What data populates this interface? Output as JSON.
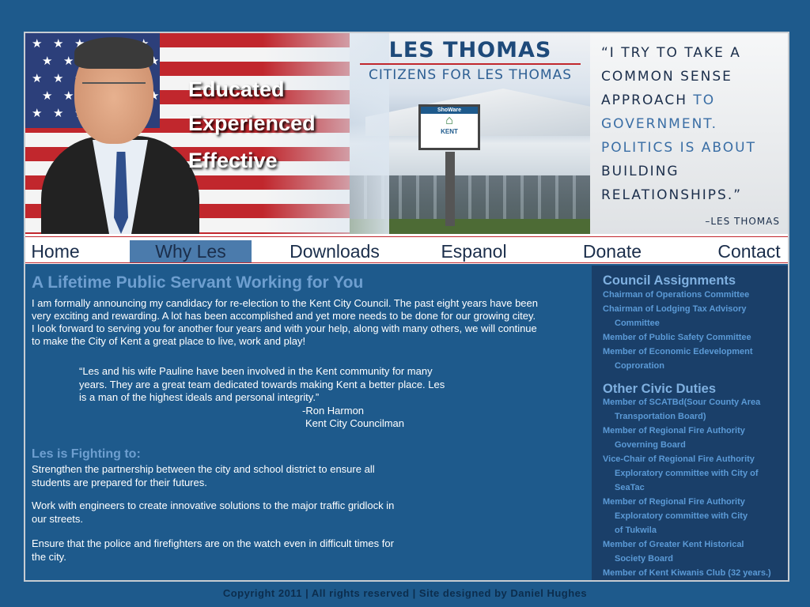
{
  "header": {
    "taglines": [
      "Educated",
      "Experienced",
      "Effective"
    ],
    "name_title": "LES THOMAS",
    "name_subtitle": "CITIZENS FOR LES THOMAS",
    "sign": {
      "top": "ShoWare",
      "text": "KENT"
    },
    "quote": [
      {
        "dark": "“I TRY TO TAKE A",
        "light": ""
      },
      {
        "dark": "COMMON SENSE",
        "light": ""
      },
      {
        "dark": "APPROACH",
        "light": " TO"
      },
      {
        "dark": "",
        "light": "GOVERNMENT."
      },
      {
        "dark": "",
        "light": "POLITICS IS ABOUT"
      },
      {
        "dark": "BUILDING",
        "light": ""
      },
      {
        "dark": "RELATIONSHIPS.”",
        "light": ""
      }
    ],
    "quote_attribution": "–LES THOMAS"
  },
  "nav": [
    "Home",
    "Why Les",
    "Downloads",
    "Espanol",
    "Donate",
    "Contact"
  ],
  "nav_active": "Why Les",
  "main": {
    "headline": "A Lifetime Public Servant Working for You",
    "intro": "I am formally announcing my candidacy for re-election to the Kent City Council.  The past eight years have been very exciting and rewarding.  A lot has been accomplished and yet more needs to be done for our growing citey.  I look forward to serving you for another four years and with your help, along with many others, we will continue to make the City of Kent a great place to live, work and play!",
    "testimonial": "“Les and his wife Pauline have been involved in the Kent community for many years. They are   a great team dedicated towards making Kent a better place.  Les is a man of the highest ideals and personal integrity.”",
    "testimonial_author": "-Ron Harmon",
    "testimonial_role": "Kent City Councilman",
    "fighting_heading": "Les is Fighting to:",
    "fighting_items": [
      "Strengthen the partnership between the city and school district to ensure all students are prepared for their futures.",
      "Work with engineers to create innovative solutions to the major traffic gridlock in our streets.",
      "Ensure that the police and firefighters are on the watch even in difficult times for the city."
    ]
  },
  "sidebar": {
    "council_heading": "Council Assignments",
    "council_lines": [
      {
        "text": "Chairman of Operations Committee",
        "indent": false
      },
      {
        "text": "Chairman of Lodging Tax Advisory",
        "indent": false
      },
      {
        "text": "Committee",
        "indent": true
      },
      {
        "text": "Member of Public Safety Committee",
        "indent": false
      },
      {
        "text": "Member of Economic Edevelopment",
        "indent": false
      },
      {
        "text": "Coproration",
        "indent": true
      }
    ],
    "civic_heading": "Other Civic Duties",
    "civic_lines": [
      {
        "text": "Member of SCATBd(Sour County Area",
        "indent": false
      },
      {
        "text": "Transportation Board)",
        "indent": true
      },
      {
        "text": "Member of Regional Fire Authority",
        "indent": false
      },
      {
        "text": "Governing Board",
        "indent": true
      },
      {
        "text": "Vice-Chair of Regional Fire Authority",
        "indent": false
      },
      {
        "text": "Exploratory committee with City of",
        "indent": true
      },
      {
        "text": "SeaTac",
        "indent": true
      },
      {
        "text": "Member of Regional Fire Authority",
        "indent": false
      },
      {
        "text": "Exploratory committee with City",
        "indent": true
      },
      {
        "text": "of Tukwila",
        "indent": true
      },
      {
        "text": "Member of Greater Kent Historical",
        "indent": false
      },
      {
        "text": "Society Board",
        "indent": true
      },
      {
        "text": "Member of Kent Kiwanis Club (32 years.)",
        "indent": false
      }
    ]
  },
  "footer": "Copyright 2011 | All rights reserved | Site designed by Daniel Hughes",
  "colors": {
    "background": "#1e5a8c",
    "accent_red": "#c1272d",
    "link_blue": "#5b9ad6",
    "sidebar": "#1a3f69"
  }
}
